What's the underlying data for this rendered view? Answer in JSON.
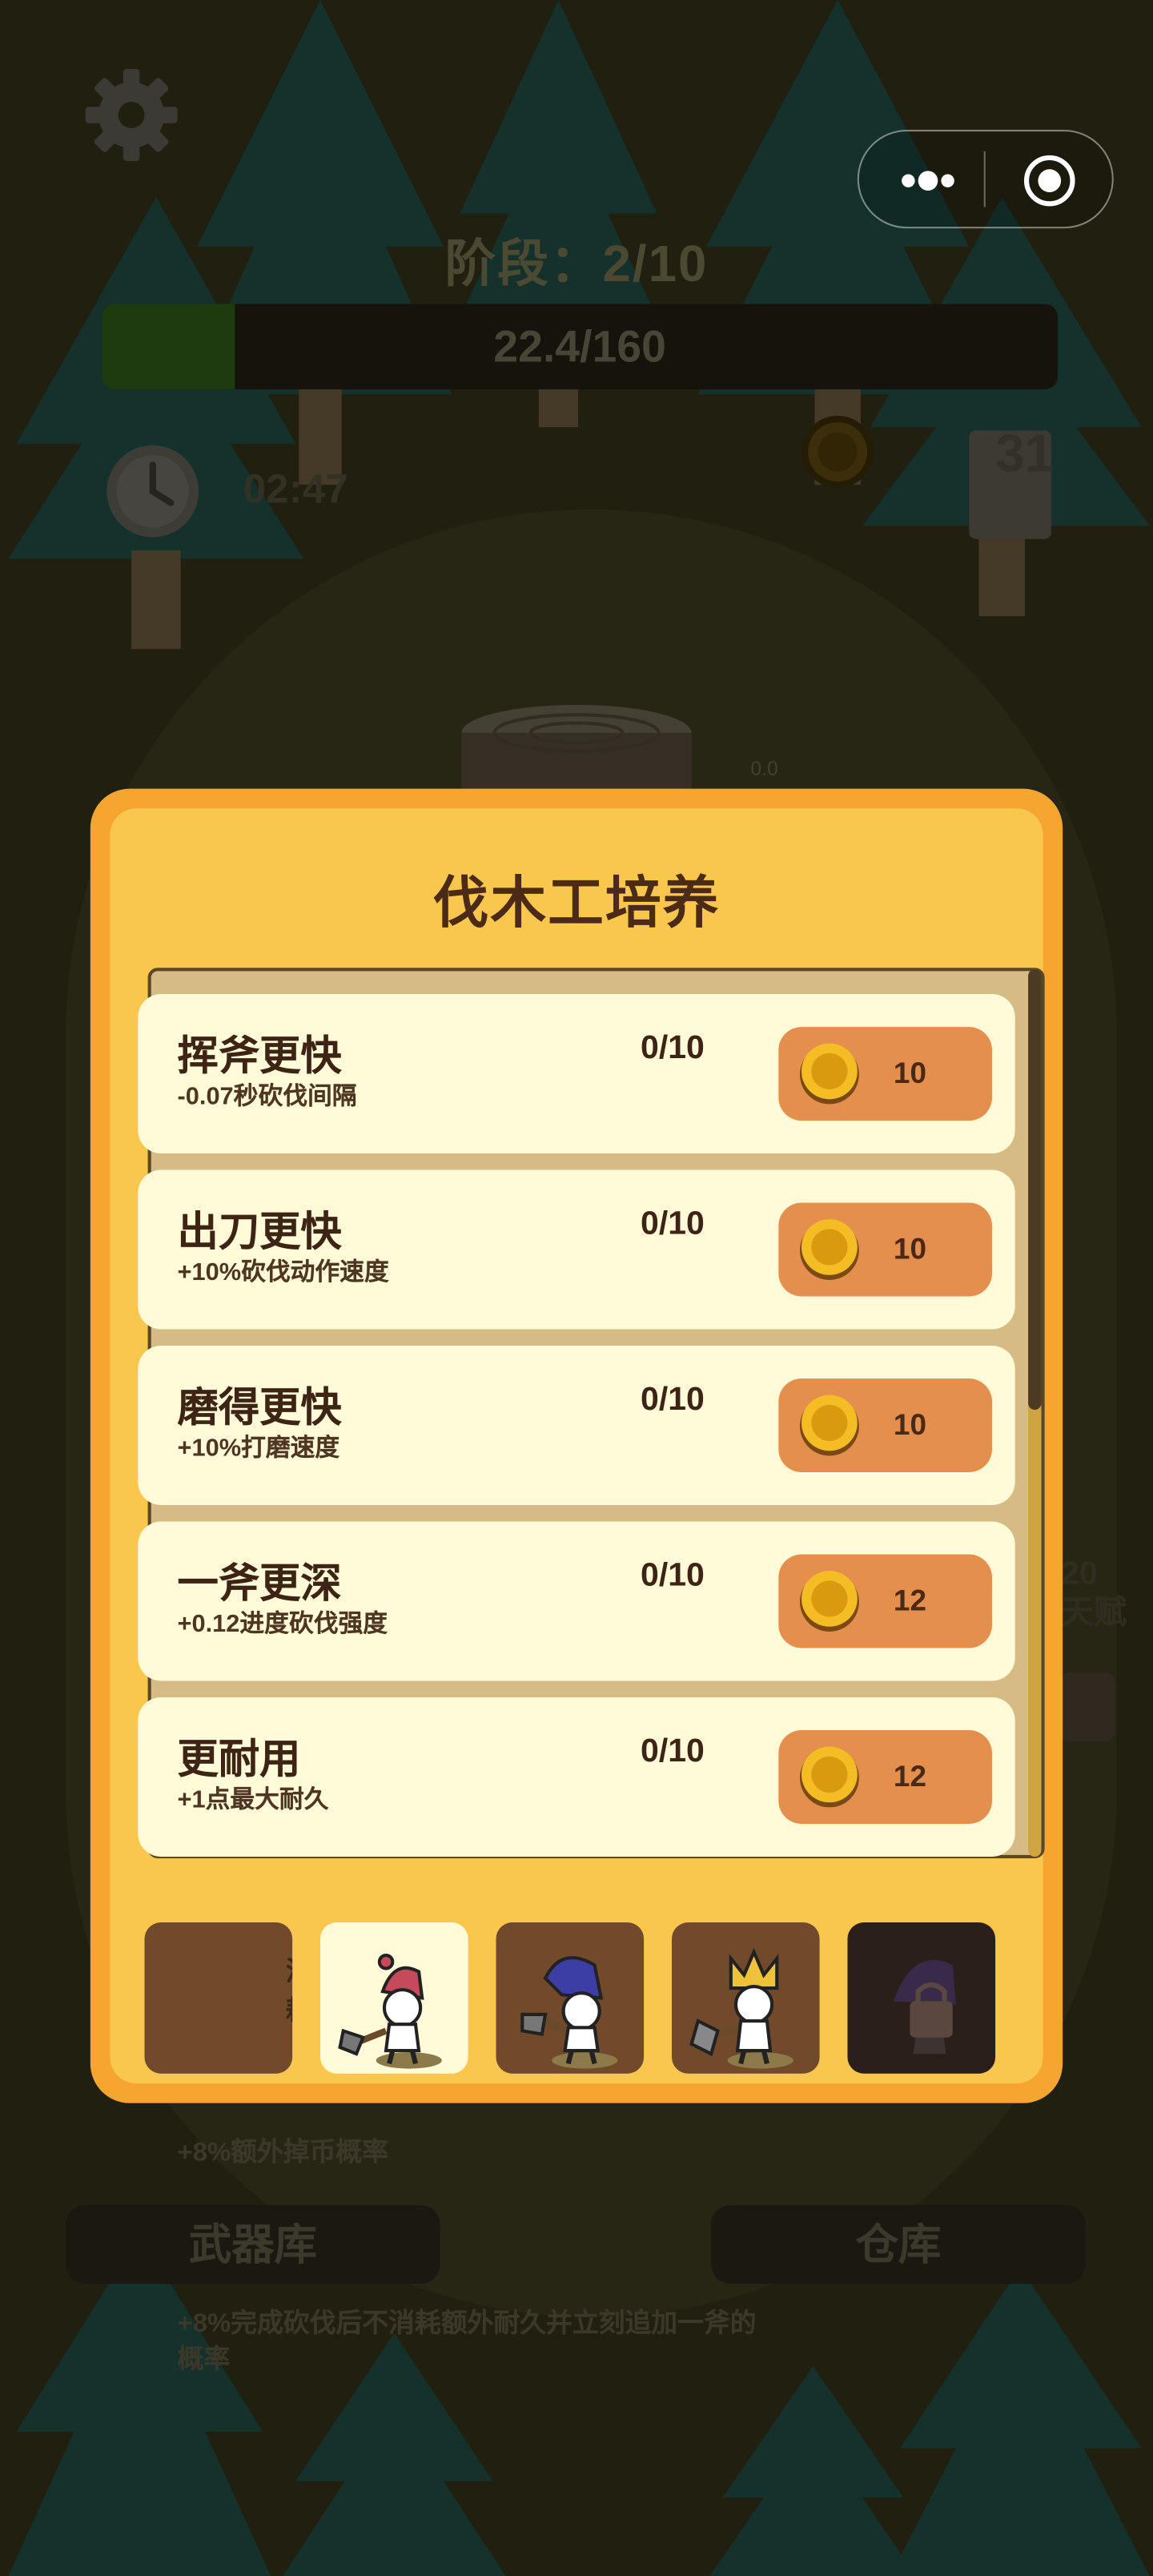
{
  "hud": {
    "stage_label": "阶段：2/10",
    "progress_text": "22.4/160",
    "progress_fraction": 0.14,
    "timer": "02:47",
    "box_count": "31",
    "stump_value": "0.0",
    "side_count": "20",
    "side_label": "天赋"
  },
  "background": {
    "bonus_text": "+8%额外掉币概率",
    "armory_button": "武器库",
    "warehouse_button": "仓库",
    "bottom_text": "+8%完成砍伐后不消耗额外耐久并立刻追加一斧的概率",
    "peek_text": "消耗"
  },
  "modal": {
    "title": "伐木工培养",
    "upgrades": [
      {
        "name": "挥斧更快",
        "desc": "-0.07秒砍伐间隔",
        "level": "0/10",
        "price": "10"
      },
      {
        "name": "出刀更快",
        "desc": "+10%砍伐动作速度",
        "level": "0/10",
        "price": "10"
      },
      {
        "name": "磨得更快",
        "desc": "+10%打磨速度",
        "level": "0/10",
        "price": "10"
      },
      {
        "name": "一斧更深",
        "desc": "+0.12进度砍伐强度",
        "level": "0/10",
        "price": "12"
      },
      {
        "name": "更耐用",
        "desc": "+1点最大耐久",
        "level": "0/10",
        "price": "12"
      }
    ],
    "tabs": [
      {
        "name": "blank",
        "state": "normal"
      },
      {
        "name": "red-hat-lumberjack",
        "state": "active"
      },
      {
        "name": "blue-hat-lumberjack",
        "state": "normal"
      },
      {
        "name": "crown-lumberjack",
        "state": "normal"
      },
      {
        "name": "locked-lumberjack",
        "state": "locked"
      }
    ]
  },
  "colors": {
    "modal_outer": "#f6a531",
    "modal_inner": "#f9c74d",
    "row_bg": "#fffbd9",
    "buy_button": "#e48f4e",
    "text_dark": "#3e2414",
    "progress_fill": "#2e5a18"
  }
}
